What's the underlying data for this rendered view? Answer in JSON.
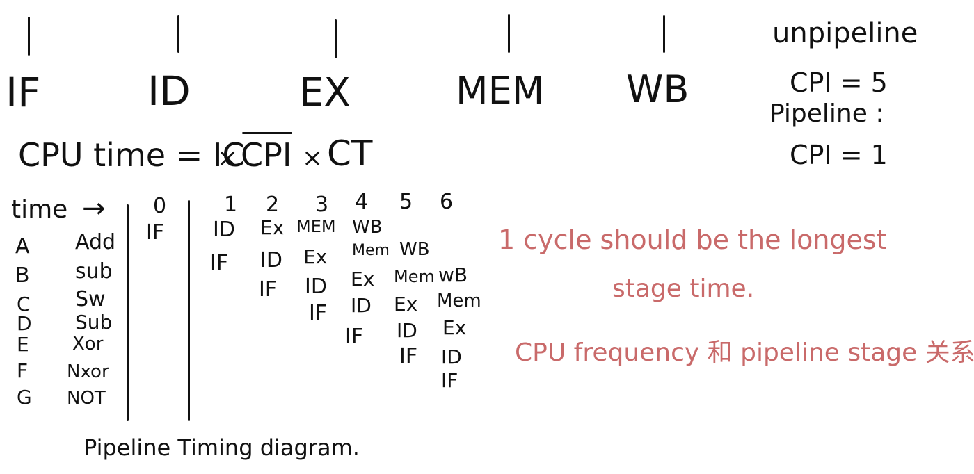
{
  "stages": [
    "IF",
    "ID",
    "EX",
    "MEM",
    "WB"
  ],
  "notes": {
    "unpipeline": "unpipeline",
    "cpi_unpipelined": "CPI = 5",
    "pipeline": "Pipeline :",
    "cpi_pipelined": "CPI = 1"
  },
  "formula": {
    "lhs": "CPU time = IC",
    "times1": "×",
    "cpi": "CPI",
    "times2": "×",
    "ct": "CT"
  },
  "timing": {
    "time_label": "time",
    "arrow": "→",
    "cycles": [
      "0",
      "1",
      "2",
      "3",
      "4",
      "5",
      "6"
    ],
    "rows": [
      {
        "id": "A",
        "op": "Add",
        "cells": [
          "IF",
          "ID",
          "Ex",
          "MEM",
          "WB"
        ]
      },
      {
        "id": "B",
        "op": "sub",
        "cells": [
          "IF",
          "ID",
          "Ex",
          "Mem",
          "WB"
        ]
      },
      {
        "id": "C",
        "op": "Sw",
        "cells": [
          "IF",
          "ID",
          "Ex",
          "Mem",
          "wB"
        ]
      },
      {
        "id": "D",
        "op": "Sub",
        "cells": [
          "IF",
          "ID",
          "Ex",
          "Mem"
        ]
      },
      {
        "id": "E",
        "op": "Xor",
        "cells": [
          "IF",
          "ID",
          "Ex"
        ]
      },
      {
        "id": "F",
        "op": "Nxor",
        "cells": [
          "IF",
          "ID"
        ]
      },
      {
        "id": "G",
        "op": "NOT",
        "cells": [
          "IF"
        ]
      }
    ],
    "caption": "Pipeline Timing diagram."
  },
  "red_notes": {
    "line1": "1 cycle should be the longest",
    "line2": "stage time.",
    "line3": "CPU frequency 和 pipeline stage 关系"
  },
  "colors": {
    "ink": "#111111",
    "red_ink": "#c96a6a",
    "background": "#ffffff"
  }
}
